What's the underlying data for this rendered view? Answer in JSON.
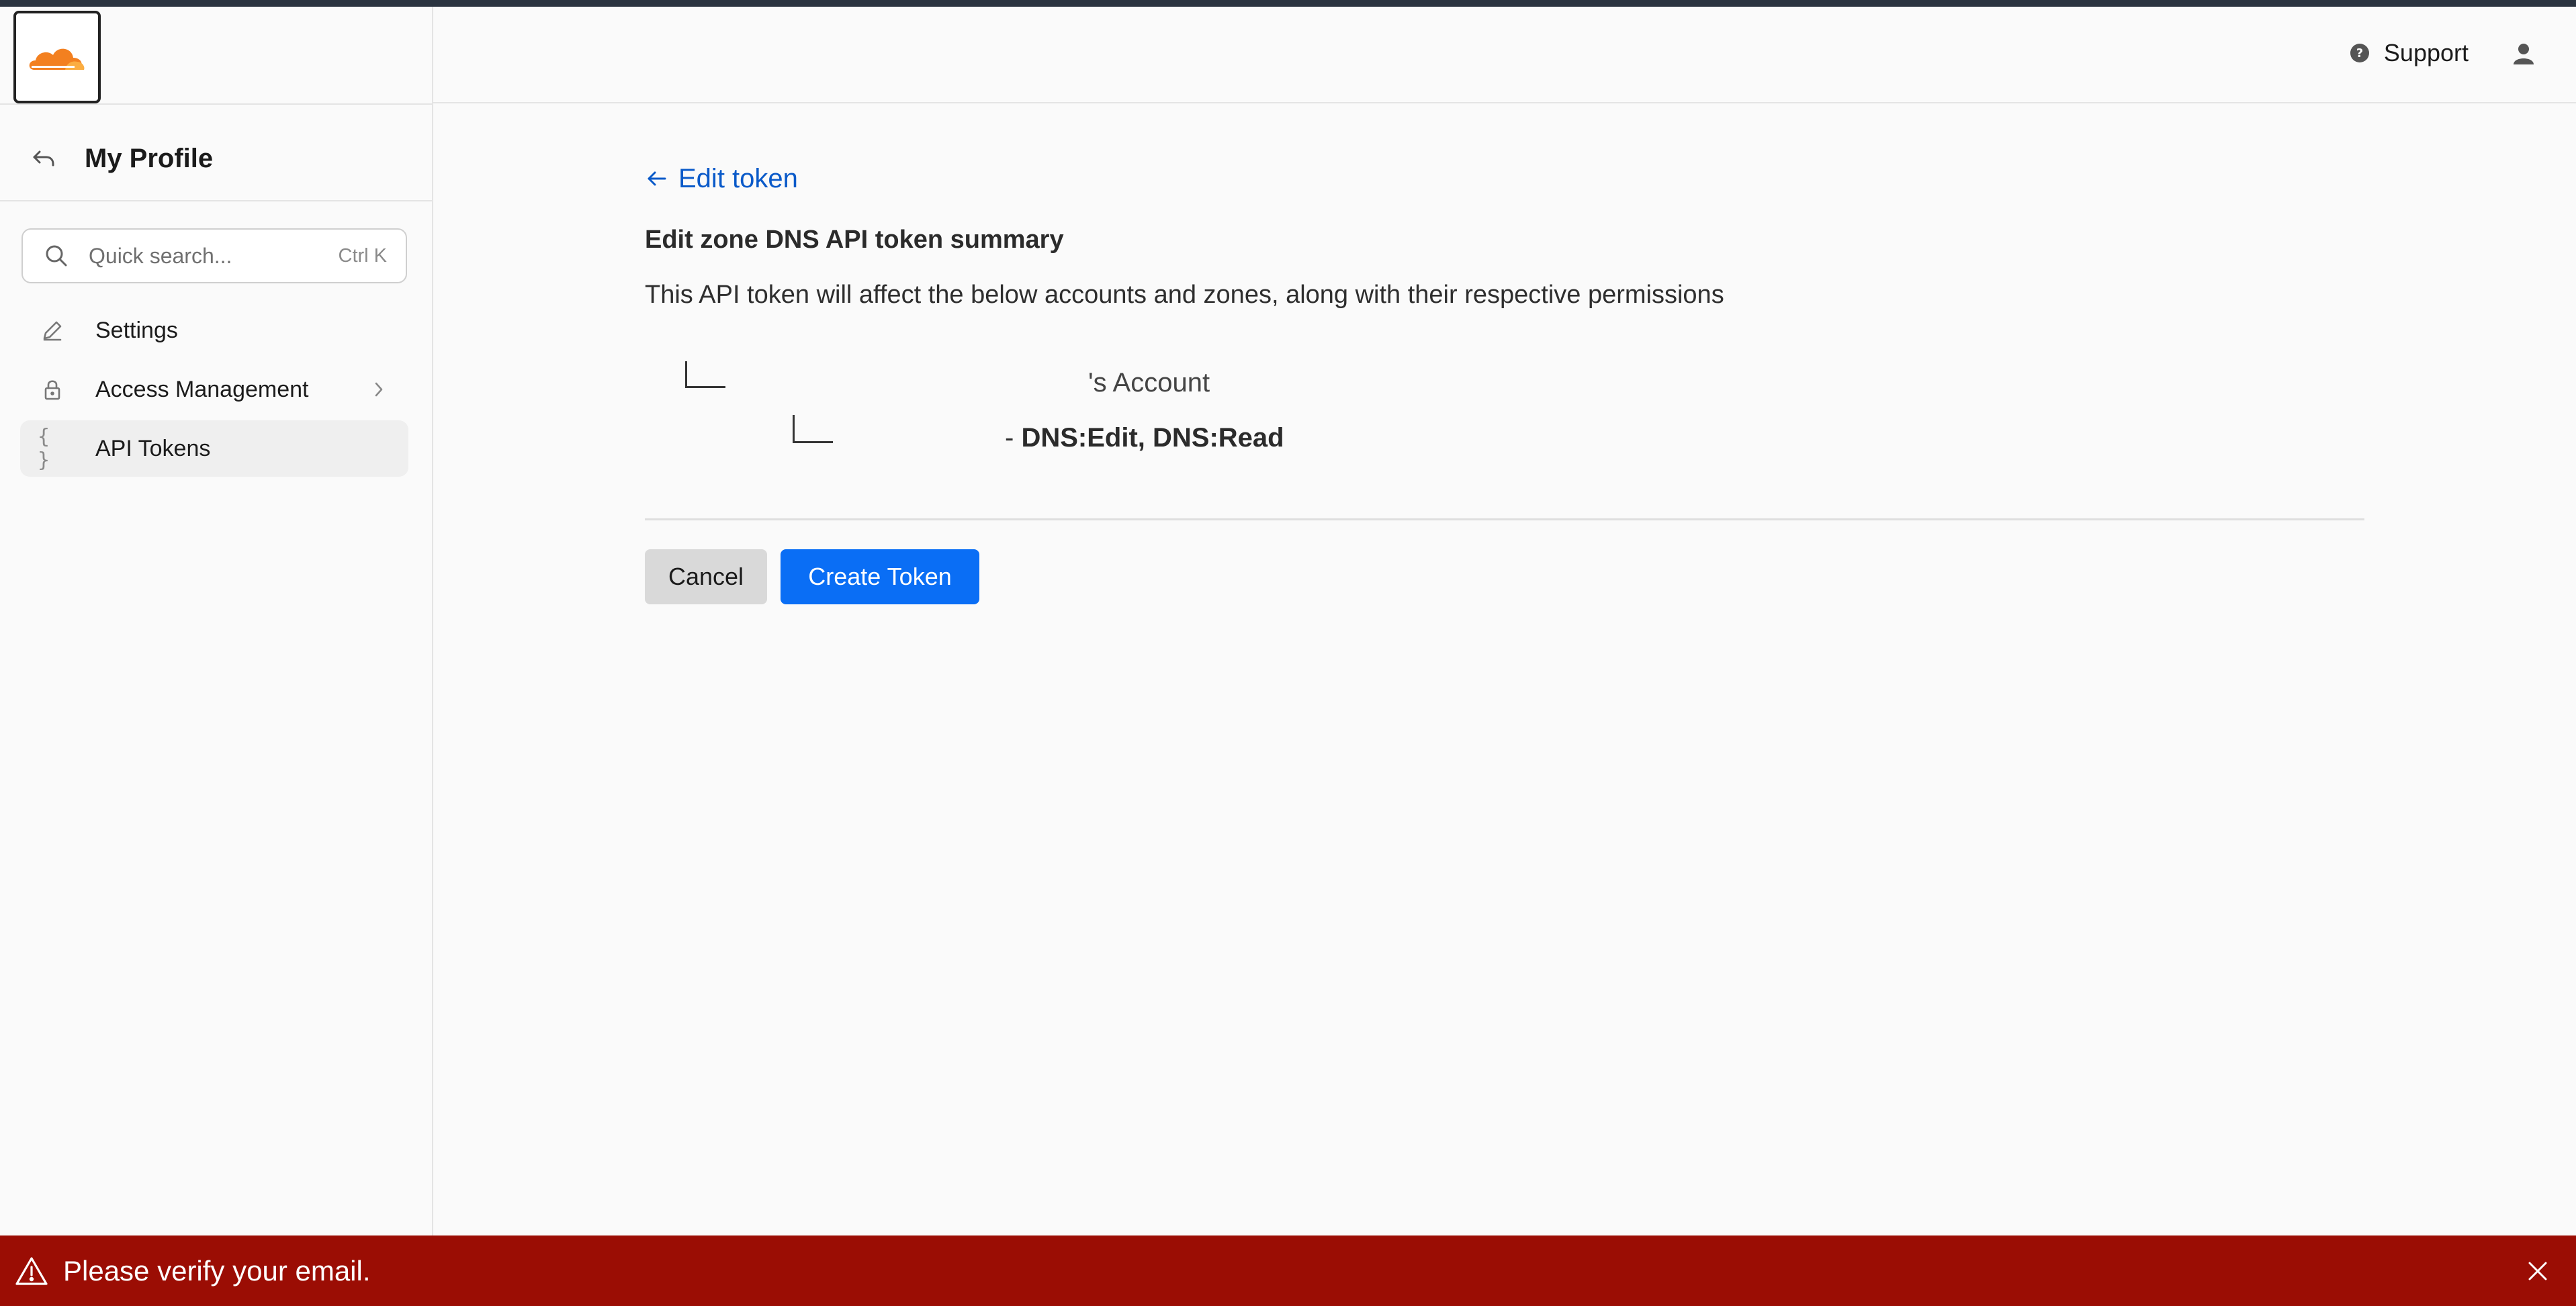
{
  "brand": {
    "logo_icon": "cloud-logo-icon",
    "accent": "#f38020"
  },
  "sidebar": {
    "back_icon": "return-arrow-icon",
    "title": "My Profile",
    "search": {
      "placeholder": "Quick search...",
      "shortcut": "Ctrl K",
      "icon": "search-icon"
    },
    "items": [
      {
        "label": "Settings",
        "icon": "pencil-icon"
      },
      {
        "label": "Access Management",
        "icon": "lock-icon",
        "has_submenu": true
      },
      {
        "label": "API Tokens",
        "icon": "braces-icon",
        "icon_text": "{ }",
        "active": true
      }
    ]
  },
  "header": {
    "support_label": "Support",
    "support_icon": "help-circle-icon",
    "user_icon": "user-icon"
  },
  "main": {
    "back_link": "Edit token",
    "summary_title": "Edit zone DNS API token summary",
    "description": "This API token will affect the below accounts and zones, along with their respective permissions",
    "account_label": "'s Account",
    "perm_prefix": "- ",
    "permissions": "DNS:Edit, DNS:Read",
    "cancel_label": "Cancel",
    "create_label": "Create Token",
    "primary_color": "#0a6ef5"
  },
  "banner": {
    "message": "Please verify your email.",
    "warning_icon": "warning-triangle-icon",
    "close_icon": "close-icon",
    "color": "#9b0d04"
  }
}
